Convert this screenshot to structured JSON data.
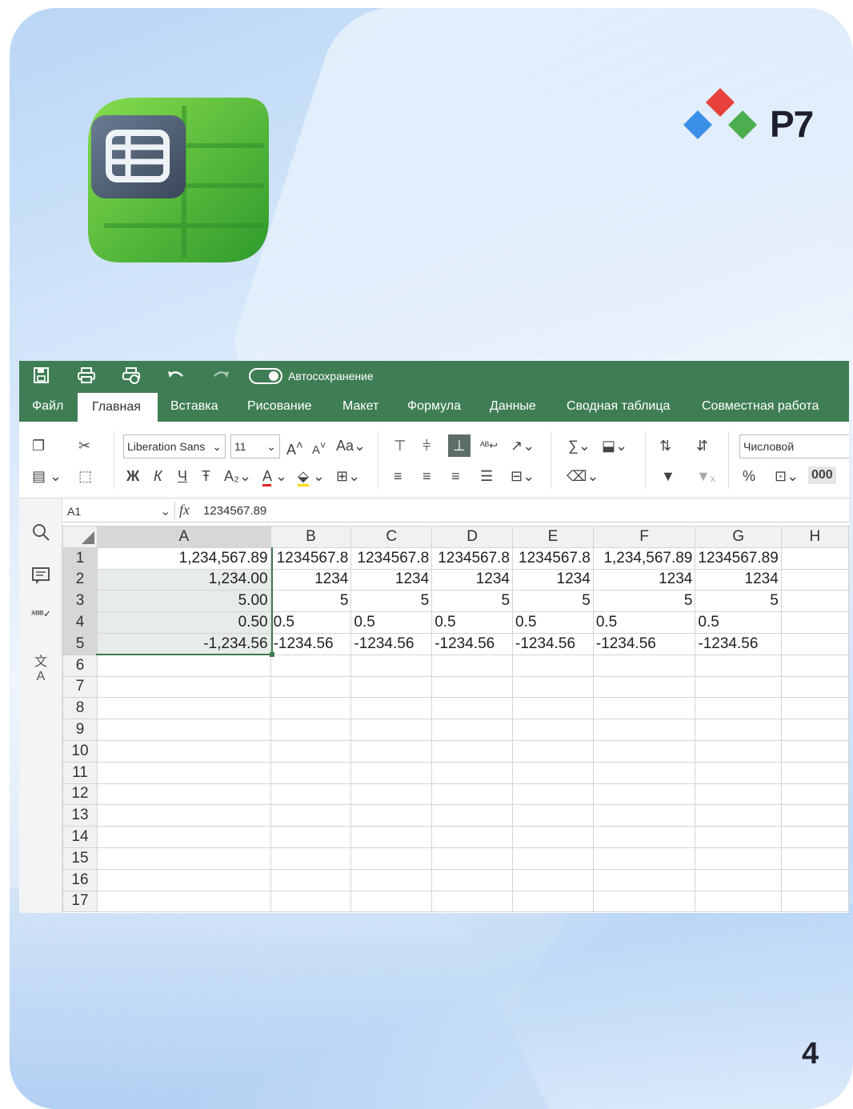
{
  "app": {
    "autosave_label": "Автосохранение",
    "brand_name": "Р7",
    "page_number": "4"
  },
  "menu": {
    "items": [
      "Файл",
      "Главная",
      "Вставка",
      "Рисование",
      "Макет",
      "Формула",
      "Данные",
      "Сводная таблица",
      "Совместная работа"
    ],
    "active_index": 1
  },
  "ribbon": {
    "font_name": "Liberation Sans",
    "font_size": "11",
    "number_format": "Числовой",
    "bold_label": "Ж",
    "italic_label": "К",
    "underline_label": "Ч",
    "thousands_label": "000",
    "percent_label": "%"
  },
  "formula_bar": {
    "cell_ref": "A1",
    "fx_label": "fx",
    "formula": "1234567.89"
  },
  "grid": {
    "columns": [
      "A",
      "B",
      "C",
      "D",
      "E",
      "F",
      "G",
      "H"
    ],
    "row_numbers": [
      "1",
      "2",
      "3",
      "4",
      "5",
      "6",
      "7",
      "8",
      "9",
      "10",
      "11",
      "12",
      "13",
      "14",
      "15",
      "16",
      "17"
    ],
    "rows": [
      [
        "1,234,567.89",
        "1234567.8",
        "1234567.8",
        "1234567.8",
        "1234567.8",
        "1,234,567.89",
        "1234567.89",
        ""
      ],
      [
        "1,234.00",
        "1234",
        "1234",
        "1234",
        "1234",
        "1234",
        "1234",
        ""
      ],
      [
        "5.00",
        "5",
        "5",
        "5",
        "5",
        "5",
        "5",
        ""
      ],
      [
        "0.50",
        "0.5",
        "0.5",
        "0.5",
        "0.5",
        "0.5",
        "0.5",
        ""
      ],
      [
        "-1,234.56",
        "-1234.56",
        "-1234.56",
        "-1234.56",
        "-1234.56",
        "-1234.56",
        "-1234.56",
        ""
      ]
    ],
    "right_aligned_rows": [
      0,
      1,
      2
    ],
    "selected_column": "A",
    "selected_rows": [
      1,
      2,
      3,
      4,
      5
    ]
  },
  "colors": {
    "header_green": "#3f7e55",
    "logo_red": "#e8413b",
    "logo_blue": "#3b8fe6",
    "logo_green": "#4cae4f"
  }
}
